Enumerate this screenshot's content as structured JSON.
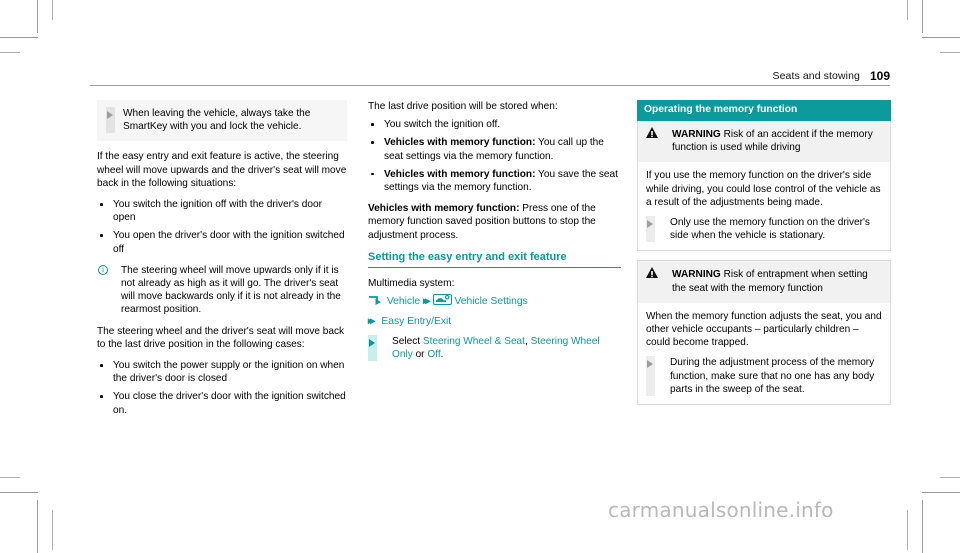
{
  "header": {
    "section_title": "Seats and stowing",
    "page_number": "109"
  },
  "colors": {
    "teal": "#0a9a9a",
    "teal_light": "#c9eeee",
    "grey_panel": "#f1f1f1"
  },
  "col1": {
    "note": "When leaving the vehicle, always take the SmartKey with you and lock the vehicle.",
    "intro": "If the easy entry and exit feature is active, the steering wheel will move upwards and the driver's seat will move back in the following situations:",
    "bullets": [
      "You switch the ignition off with the driver's door open",
      "You open the driver's door with the ignition switched off"
    ],
    "info_icon": "info-circle-icon",
    "info": "The steering wheel will move upwards only if it is not already as high as it will go. The driver's seat will move backwards only if it is not already in the rearmost position.",
    "intro2": "The steering wheel and the driver's seat will move back to the last drive position in the following cases:",
    "bullets2": [
      "You switch the power supply or the ignition on when the driver's door is closed",
      "You close the driver's door with the ignition switched on."
    ]
  },
  "col2": {
    "intro": "The last drive position will be stored when:",
    "bullet1": "You switch the ignition off.",
    "bullet2_bold": "Vehicles with memory function:",
    "bullet2_rest": " You call up the seat settings via the memory function.",
    "bullet3_bold": "Vehicles with memory function:",
    "bullet3_rest": " You save the seat settings via the memory function.",
    "para_bold": "Vehicles with memory function:",
    "para_rest": " Press one of the memory function saved position buttons to stop the adjustment process.",
    "section_heading": "Setting the easy entry and exit feature",
    "multimedia_label": "Multimedia system:",
    "path": {
      "enter_icon": "enter-arrow-icon",
      "item1": "Vehicle",
      "separator": "▸▸",
      "settings_icon": "vehicle-settings-icon",
      "item2": "Vehicle Settings",
      "item3": "Easy Entry/Exit"
    },
    "select_label": "Select ",
    "option1": "Steering Wheel & Seat",
    "comma": ", ",
    "option2": "Steering Wheel Only",
    "or": " or ",
    "option3": "Off",
    "period": "."
  },
  "col3": {
    "bar_title": "Operating the memory function",
    "warnings": [
      {
        "icon": "warning-triangle-icon",
        "label": "WARNING",
        "title": " Risk of an accident if the memory function is used while driving",
        "body": "If you use the memory function on the driver's side while driving, you could lose control of the vehicle as a result of the adjustments being made.",
        "action": "Only use the memory function on the driver's side when the vehicle is stationary."
      },
      {
        "icon": "warning-triangle-icon",
        "label": "WARNING",
        "title": " Risk of entrapment when setting the seat with the memory function",
        "body": "When the memory function adjusts the seat, you and other vehicle occupants – particularly children – could become trapped.",
        "action": "During the adjustment process of the memory function, make sure that no one has any body parts in the sweep of the seat."
      }
    ]
  },
  "watermark": {
    "text": "carmanualsonline.info"
  }
}
